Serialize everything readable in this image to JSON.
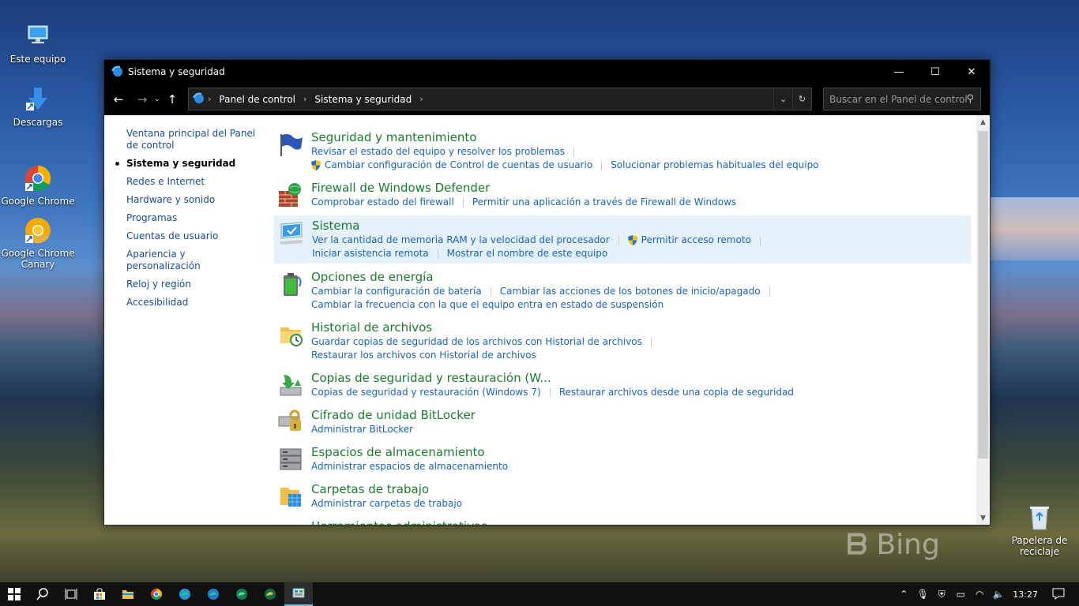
{
  "desktop": {
    "icons": [
      {
        "label": "Este equipo"
      },
      {
        "label": "Descargas"
      },
      {
        "label": "Google Chrome"
      },
      {
        "label": "Google Chrome Canary"
      },
      {
        "label": "Papelera de reciclaje"
      }
    ],
    "watermark": "Bing"
  },
  "window": {
    "title": "Sistema y seguridad",
    "controls": {
      "minimize": "—",
      "maximize": "☐",
      "close": "✕"
    }
  },
  "address": {
    "crumbs": [
      "Panel de control",
      "Sistema y seguridad"
    ],
    "search_placeholder": "Buscar en el Panel de control"
  },
  "leftnav": {
    "items": [
      {
        "label": "Ventana principal del Panel de control",
        "active": false
      },
      {
        "label": "Sistema y seguridad",
        "active": true
      },
      {
        "label": "Redes e Internet",
        "active": false
      },
      {
        "label": "Hardware y sonido",
        "active": false
      },
      {
        "label": "Programas",
        "active": false
      },
      {
        "label": "Cuentas de usuario",
        "active": false
      },
      {
        "label": "Apariencia y personalización",
        "active": false
      },
      {
        "label": "Reloj y región",
        "active": false
      },
      {
        "label": "Accesibilidad",
        "active": false
      }
    ]
  },
  "categories": [
    {
      "title": "Seguridad y mantenimiento",
      "icon": "flag-icon",
      "links": [
        "Revisar el estado del equipo y resolver los problemas",
        "Cambiar configuración de Control de cuentas de usuario",
        "Solucionar problemas habituales del equipo"
      ]
    },
    {
      "title": "Firewall de Windows Defender",
      "icon": "firewall-icon",
      "links": [
        "Comprobar estado del firewall",
        "Permitir una aplicación a través de Firewall de Windows"
      ]
    },
    {
      "title": "Sistema",
      "icon": "system-icon",
      "links": [
        "Ver la cantidad de memoria RAM y la velocidad del procesador",
        "Permitir acceso remoto",
        "Iniciar asistencia remota",
        "Mostrar el nombre de este equipo"
      ]
    },
    {
      "title": "Opciones de energía",
      "icon": "power-icon",
      "links": [
        "Cambiar la configuración de batería",
        "Cambiar las acciones de los botones de inicio/apagado",
        "Cambiar la frecuencia con la que el equipo entra en estado de suspensión"
      ]
    },
    {
      "title": "Historial de archivos",
      "icon": "file-history-icon",
      "links": [
        "Guardar copias de seguridad de los archivos con Historial de archivos",
        "Restaurar los archivos con Historial de archivos"
      ]
    },
    {
      "title": "Copias de seguridad y restauración (W...",
      "icon": "backup-icon",
      "links": [
        "Copias de seguridad y restauración (Windows 7)",
        "Restaurar archivos desde una copia de seguridad"
      ]
    },
    {
      "title": "Cifrado de unidad BitLocker",
      "icon": "bitlocker-icon",
      "links": [
        "Administrar BitLocker"
      ]
    },
    {
      "title": "Espacios de almacenamiento",
      "icon": "storage-icon",
      "links": [
        "Administrar espacios de almacenamiento"
      ]
    },
    {
      "title": "Carpetas de trabajo",
      "icon": "work-folders-icon",
      "links": [
        "Administrar carpetas de trabajo"
      ]
    },
    {
      "title": "Herramientas administrativas",
      "icon": "admin-tools-icon",
      "links": []
    }
  ],
  "taskbar": {
    "clock": "13:27"
  },
  "colors": {
    "link": "#1a63b3",
    "category_title": "#1e7a30",
    "highlight": "#e5f1fb"
  }
}
